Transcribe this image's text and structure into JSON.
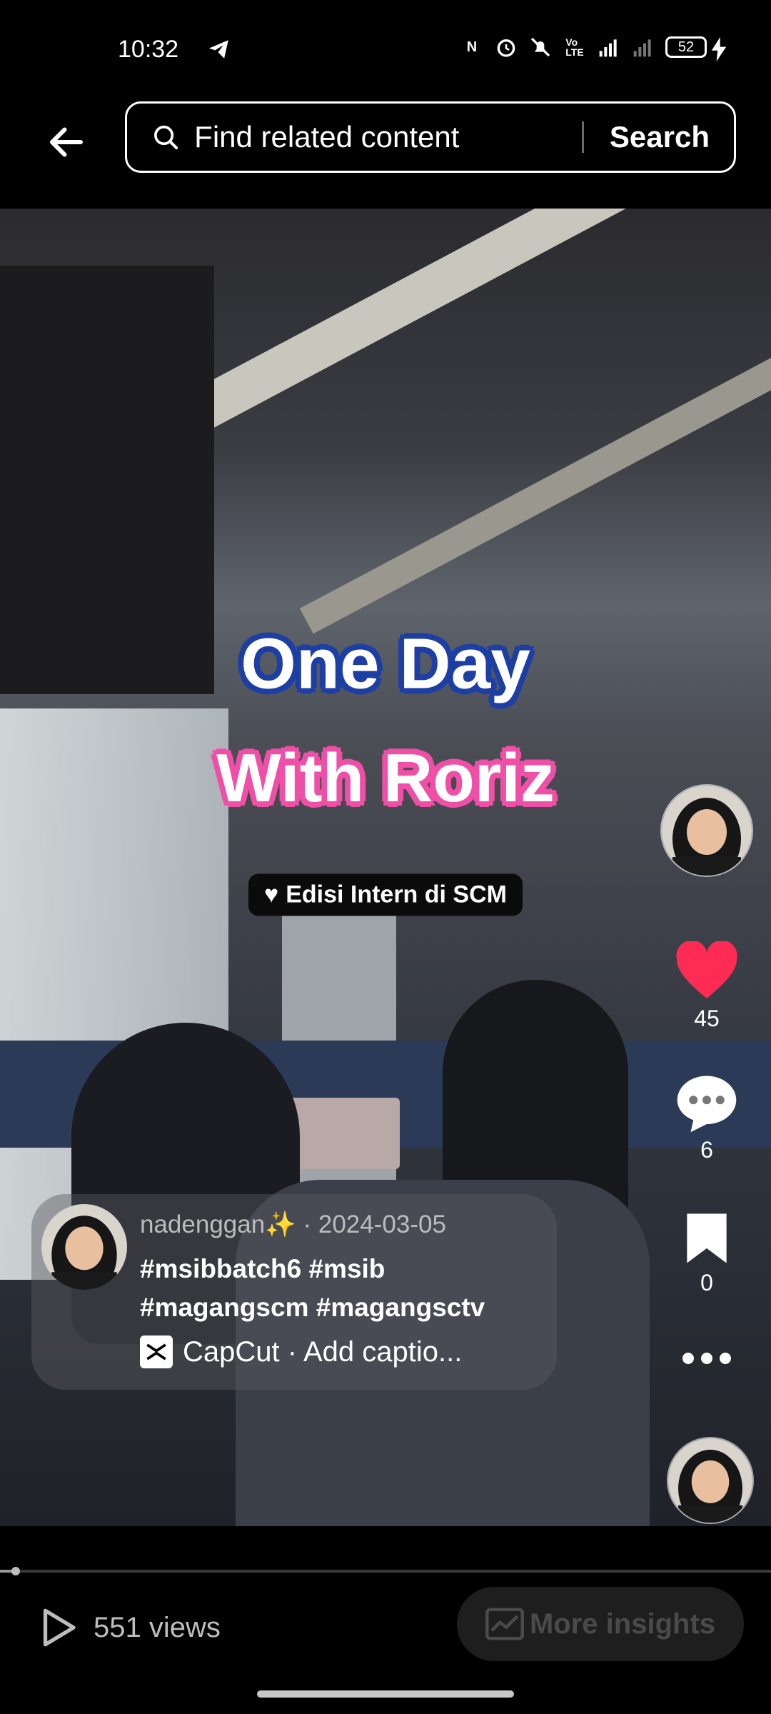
{
  "status_bar": {
    "time": "10:32",
    "battery": "52",
    "icons": [
      "telegram-icon",
      "nfc-icon",
      "alarm-icon",
      "bell-off-icon",
      "volte-icon",
      "4g-signal-icon",
      "signal-icon",
      "battery-icon",
      "charging-icon"
    ]
  },
  "header": {
    "search_placeholder": "Find related content",
    "search_button": "Search"
  },
  "video": {
    "overlay_title_line1": "One Day",
    "overlay_title_line2": "With Roriz",
    "overlay_tag": "Edisi Intern di SCM"
  },
  "rail": {
    "likes": "45",
    "comments": "6",
    "saves": "0",
    "like_color": "#fe2c55"
  },
  "caption": {
    "meta": "nadenggan✨ · 2024-03-05",
    "text_line1": "#msibbatch6 #msib",
    "text_line2": "#magangscm #magangsctv",
    "capcut_label": "CapCut · Add captio..."
  },
  "playback": {
    "progress_percent": 2
  },
  "bottom_bar": {
    "views": "551 views",
    "insights_label": "More insights"
  }
}
